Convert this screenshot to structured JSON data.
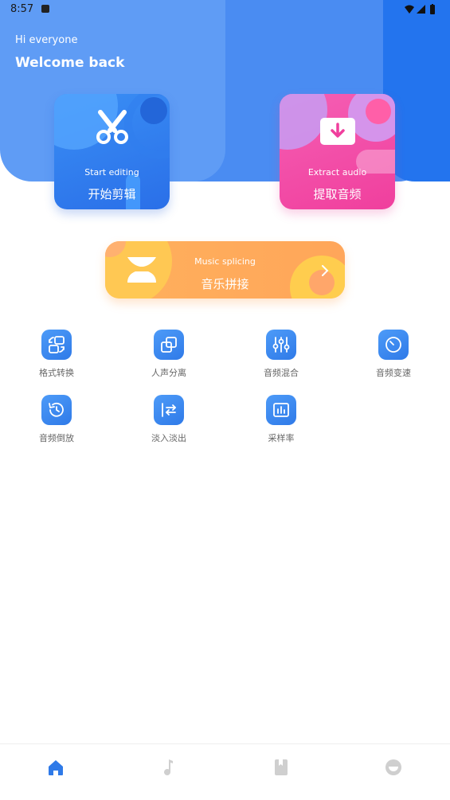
{
  "status_bar": {
    "time": "8:57"
  },
  "header": {
    "greeting": "Hi everyone",
    "welcome": "Welcome back"
  },
  "cards": {
    "edit": {
      "en": "Start editing",
      "cn": "开始剪辑",
      "icon": "scissors-icon"
    },
    "extract": {
      "en": "Extract audio",
      "cn": "提取音频",
      "icon": "download-icon"
    },
    "splice": {
      "en": "Music splicing",
      "cn": "音乐拼接",
      "icon": "hourglass-icon"
    }
  },
  "tools": [
    {
      "label": "格式转换",
      "icon": "format-convert-icon"
    },
    {
      "label": "人声分离",
      "icon": "vocal-separate-icon"
    },
    {
      "label": "音频混合",
      "icon": "audio-mix-icon"
    },
    {
      "label": "音频变速",
      "icon": "speed-change-icon"
    },
    {
      "label": "音频倒放",
      "icon": "reverse-play-icon"
    },
    {
      "label": "淡入淡出",
      "icon": "fade-in-out-icon"
    },
    {
      "label": "采样率",
      "icon": "sample-rate-icon"
    }
  ],
  "nav": [
    {
      "icon": "home-icon",
      "active": true
    },
    {
      "icon": "music-note-icon",
      "active": false
    },
    {
      "icon": "book-icon",
      "active": false
    },
    {
      "icon": "profile-icon",
      "active": false
    }
  ],
  "colors": {
    "primary": "#2f7ae8",
    "header": "#5f9cf5",
    "pink": "#f03f9d",
    "orange": "#ffa65a",
    "nav_inactive": "#cfcfcf"
  }
}
